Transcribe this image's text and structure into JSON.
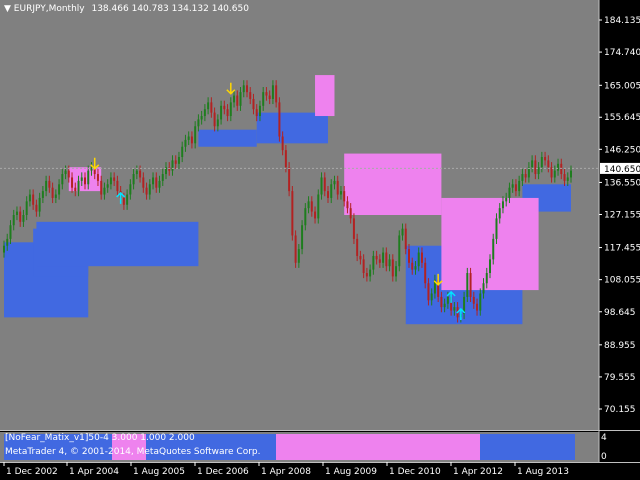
{
  "symbol_header": {
    "symbol": "EURJPY,Monthly",
    "ohlc": "138.466 140.783 134.132 140.650"
  },
  "colors": {
    "background": "#808080",
    "bull_candle": "#1e7d1e",
    "bear_candle": "#b22222",
    "blue_band": "#4169e1",
    "pink_band": "#ee82ee",
    "up_arrow": "#00e5ff",
    "down_arrow": "#ffd700"
  },
  "current_price": "140.650",
  "indicator": {
    "label": "[NoFear_Matix_v1]50-4 3.000 1.000 2.000",
    "scale_top": "4",
    "scale_bottom": "0"
  },
  "copyright": "MetaTrader 4, © 2001-2014, MetaQuotes Software Corp.",
  "chart_data": {
    "type": "candlestick",
    "y_axis_ticks": [
      "184.135",
      "174.740",
      "165.005",
      "155.645",
      "146.250",
      "136.550",
      "127.155",
      "117.455",
      "108.055",
      "98.645",
      "88.955",
      "79.555",
      "70.155"
    ],
    "x_axis_ticks": [
      "1 Dec 2002",
      "1 Apr 2004",
      "1 Aug 2005",
      "1 Dec 2006",
      "1 Apr 2008",
      "1 Aug 2009",
      "1 Dec 2010",
      "1 Apr 2012",
      "1 Aug 2013"
    ],
    "ylim": [
      64,
      190
    ],
    "closes": [
      118,
      120,
      124,
      127,
      128,
      125,
      127,
      131,
      133,
      130,
      128,
      132,
      134,
      137,
      135,
      132,
      133,
      136,
      139,
      140,
      138,
      135,
      134,
      137,
      138,
      136,
      140,
      141,
      139,
      137,
      133,
      135,
      136,
      138,
      137,
      134,
      132,
      130,
      133,
      136,
      139,
      140,
      138,
      135,
      133,
      136,
      138,
      135,
      137,
      139,
      141,
      140,
      143,
      142,
      144,
      147,
      149,
      150,
      148,
      153,
      155,
      156,
      158,
      160,
      157,
      153,
      155,
      159,
      158,
      156,
      160,
      162,
      159,
      163,
      165,
      163,
      161,
      158,
      156,
      159,
      163,
      162,
      161,
      165,
      160,
      150,
      146,
      141,
      134,
      121,
      113,
      117,
      124,
      129,
      131,
      128,
      126,
      133,
      138,
      134,
      132,
      136,
      137,
      133,
      134,
      131,
      129,
      126,
      120,
      115,
      114,
      110,
      109,
      111,
      115,
      114,
      113,
      116,
      112,
      114,
      109,
      112,
      121,
      123,
      117,
      113,
      111,
      112,
      116,
      113,
      107,
      102,
      104,
      108,
      103,
      100,
      101,
      103,
      99,
      100,
      97,
      98,
      103,
      110,
      103,
      101,
      99,
      104,
      107,
      110,
      114,
      120,
      126,
      129,
      131,
      132,
      135,
      136,
      134,
      137,
      139,
      138,
      141,
      143,
      139,
      141,
      144,
      143,
      141,
      138,
      140,
      142,
      139,
      137,
      138,
      140
    ],
    "blue_band": [
      [
        0,
        26,
        97,
        119
      ],
      [
        9,
        26,
        109,
        123
      ],
      [
        10,
        60,
        112,
        125
      ],
      [
        60,
        78,
        147,
        152
      ],
      [
        78,
        100,
        148,
        157
      ],
      [
        124,
        160,
        95,
        118
      ],
      [
        160,
        175,
        128,
        136
      ]
    ],
    "pink_band": [
      [
        20,
        30,
        134,
        141
      ],
      [
        96,
        102,
        156,
        168
      ],
      [
        105,
        135,
        127,
        145
      ],
      [
        135,
        165,
        105,
        132
      ]
    ],
    "indicator_segments": [
      {
        "from": "start",
        "to": "2005",
        "color": "blue"
      },
      {
        "from": "2005",
        "to": "2006",
        "color": "pink"
      },
      {
        "from": "2006",
        "to": "2008",
        "color": "blue"
      },
      {
        "from": "2008",
        "to": "2012",
        "color": "pink"
      },
      {
        "from": "2012",
        "to": "end",
        "color": "blue"
      }
    ],
    "signals": [
      {
        "index": 28,
        "type": "down",
        "price": 142
      },
      {
        "index": 36,
        "type": "up",
        "price": 132
      },
      {
        "index": 70,
        "type": "down",
        "price": 164
      },
      {
        "index": 134,
        "type": "down",
        "price": 108
      },
      {
        "index": 138,
        "type": "up",
        "price": 103
      },
      {
        "index": 141,
        "type": "up",
        "price": 98
      }
    ]
  }
}
